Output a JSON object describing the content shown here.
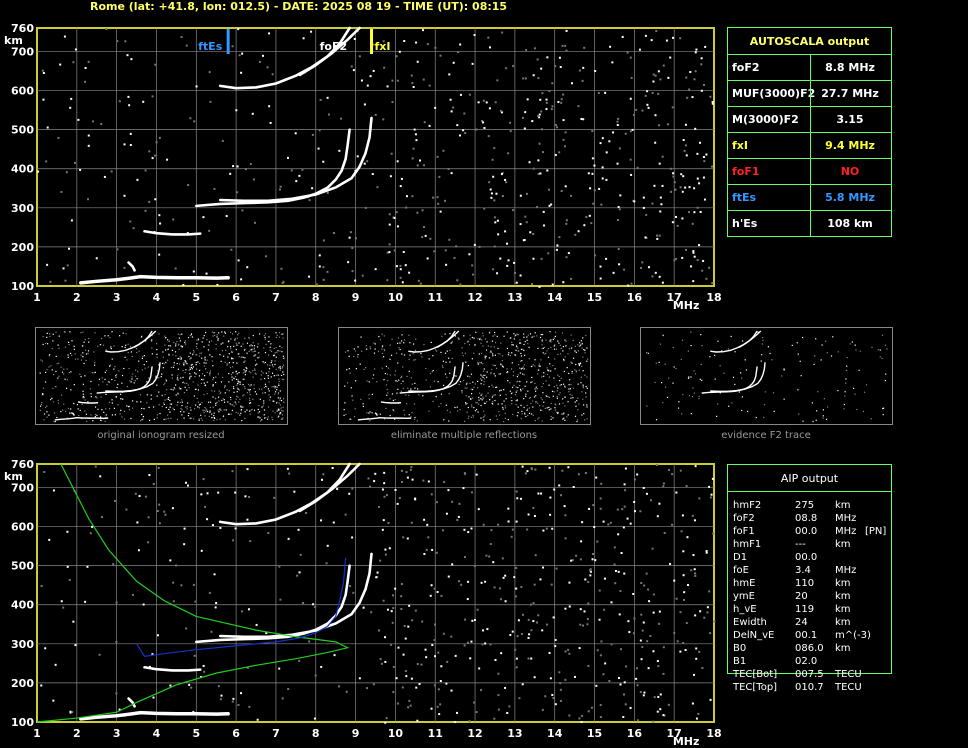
{
  "header": "Rome (lat: +41.8, lon: 012.5) - DATE: 2025 08 19 - TIME (UT): 08:15",
  "axes": {
    "y_ticks": [
      "100",
      "200",
      "300",
      "400",
      "500",
      "600",
      "700",
      "760"
    ],
    "y_unit": "km",
    "x_ticks": [
      "1",
      "2",
      "3",
      "4",
      "5",
      "6",
      "7",
      "8",
      "9",
      "10",
      "11",
      "12",
      "13",
      "14",
      "15",
      "16",
      "17",
      "18"
    ],
    "x_unit": "MHz"
  },
  "markers": [
    {
      "label": "ftEs",
      "freq": 5.8,
      "color": "#3399ff"
    },
    {
      "label": "foF2",
      "freq": 8.8,
      "color": "#ffffff"
    },
    {
      "label": "fxI",
      "freq": 9.4,
      "color": "#ffff33"
    }
  ],
  "autoscala": {
    "title": "AUTOSCALA output",
    "rows": [
      {
        "label": "foF2",
        "value": "8.8 MHz",
        "color": "#ffffff"
      },
      {
        "label": "MUF(3000)F2",
        "value": "27.7 MHz",
        "color": "#ffffff"
      },
      {
        "label": "M(3000)F2",
        "value": "3.15",
        "color": "#ffffff"
      },
      {
        "label": "fxI",
        "value": "9.4 MHz",
        "color": "#ffff33"
      },
      {
        "label": "foF1",
        "value": "NO",
        "color": "#ff2222"
      },
      {
        "label": "ftEs",
        "value": "5.8 MHz",
        "color": "#3399ff"
      },
      {
        "label": "h'Es",
        "value": "108    km",
        "color": "#ffffff"
      }
    ]
  },
  "thumbnails": [
    {
      "caption": "original ionogram resized"
    },
    {
      "caption": "eliminate multiple reflections"
    },
    {
      "caption": "evidence F2 trace"
    }
  ],
  "aip": {
    "title": "AIP output",
    "rows": [
      {
        "name": "hmF2",
        "value": "275",
        "unit": "km",
        "extra": ""
      },
      {
        "name": "foF2",
        "value": "08.8",
        "unit": "MHz",
        "extra": ""
      },
      {
        "name": "foF1",
        "value": "00.0",
        "unit": "MHz",
        "extra": "[PN]"
      },
      {
        "name": "hmF1",
        "value": "---",
        "unit": "km",
        "extra": ""
      },
      {
        "name": "D1",
        "value": "00.0",
        "unit": "",
        "extra": ""
      },
      {
        "name": "foE",
        "value": "3.4",
        "unit": "MHz",
        "extra": ""
      },
      {
        "name": "hmE",
        "value": "110",
        "unit": "km",
        "extra": ""
      },
      {
        "name": "ymE",
        "value": "20",
        "unit": "km",
        "extra": ""
      },
      {
        "name": "h_vE",
        "value": "119",
        "unit": "km",
        "extra": ""
      },
      {
        "name": "Ewidth",
        "value": "24",
        "unit": "km",
        "extra": ""
      },
      {
        "name": "DelN_vE",
        "value": "00.1",
        "unit": "m^(-3)",
        "extra": ""
      },
      {
        "name": "B0",
        "value": "086.0",
        "unit": "km",
        "extra": ""
      },
      {
        "name": "B1",
        "value": "02.0",
        "unit": "",
        "extra": ""
      },
      {
        "name": "TEC[Bot]",
        "value": "007.5",
        "unit": "TECU",
        "extra": ""
      },
      {
        "name": "TEC[Top]",
        "value": "010.7",
        "unit": "TECU",
        "extra": ""
      }
    ]
  },
  "chart_data": {
    "type": "scatter",
    "xlabel": "MHz",
    "ylabel": "km",
    "xlim": [
      1,
      18
    ],
    "ylim": [
      100,
      760
    ],
    "grid": true,
    "colors": {
      "frame": "#cccc33",
      "grid": "#888888",
      "trace": "#ffffff",
      "profile": "#22cc22",
      "fitted": "#1133cc"
    },
    "series": [
      {
        "role": "E-trace",
        "points": [
          [
            2.1,
            108
          ],
          [
            2.5,
            112
          ],
          [
            3.0,
            116
          ],
          [
            3.4,
            121
          ],
          [
            3.6,
            124
          ],
          [
            4.0,
            122
          ],
          [
            4.5,
            121
          ],
          [
            5.0,
            121
          ],
          [
            5.5,
            120
          ],
          [
            5.8,
            121
          ]
        ]
      },
      {
        "role": "Es-blob",
        "points": [
          [
            3.3,
            160
          ],
          [
            3.4,
            150
          ],
          [
            3.45,
            140
          ]
        ]
      },
      {
        "role": "E2-trace",
        "points": [
          [
            3.7,
            240
          ],
          [
            4.0,
            235
          ],
          [
            4.4,
            232
          ],
          [
            4.8,
            232
          ],
          [
            5.1,
            234
          ]
        ]
      },
      {
        "role": "F-lower",
        "points": [
          [
            5.0,
            305
          ],
          [
            5.6,
            310
          ],
          [
            6.2,
            312
          ],
          [
            6.8,
            314
          ],
          [
            7.3,
            318
          ],
          [
            7.7,
            326
          ],
          [
            8.0,
            336
          ],
          [
            8.3,
            352
          ],
          [
            8.5,
            372
          ],
          [
            8.65,
            395
          ],
          [
            8.75,
            425
          ],
          [
            8.8,
            460
          ],
          [
            8.85,
            500
          ]
        ]
      },
      {
        "role": "F-upper",
        "points": [
          [
            5.6,
            320
          ],
          [
            6.2,
            318
          ],
          [
            6.8,
            318
          ],
          [
            7.4,
            323
          ],
          [
            8.0,
            334
          ],
          [
            8.5,
            352
          ],
          [
            8.9,
            376
          ],
          [
            9.1,
            405
          ],
          [
            9.25,
            440
          ],
          [
            9.35,
            480
          ],
          [
            9.4,
            530
          ]
        ]
      },
      {
        "role": "F-high",
        "points": [
          [
            5.6,
            612
          ],
          [
            6.0,
            606
          ],
          [
            6.5,
            608
          ],
          [
            7.0,
            618
          ],
          [
            7.5,
            638
          ],
          [
            7.9,
            660
          ],
          [
            8.3,
            688
          ],
          [
            8.6,
            720
          ],
          [
            8.85,
            760
          ]
        ]
      },
      {
        "role": "F-high-x",
        "points": [
          [
            7.6,
            640
          ],
          [
            8.0,
            665
          ],
          [
            8.4,
            695
          ],
          [
            8.8,
            730
          ],
          [
            9.1,
            760
          ]
        ]
      },
      {
        "role": "density-profile",
        "points": [
          [
            1.0,
            100
          ],
          [
            2.0,
            110
          ],
          [
            3.0,
            125
          ],
          [
            3.5,
            150
          ],
          [
            4.5,
            195
          ],
          [
            5.5,
            225
          ],
          [
            6.5,
            245
          ],
          [
            7.5,
            262
          ],
          [
            8.3,
            278
          ],
          [
            8.8,
            290
          ],
          [
            8.5,
            305
          ],
          [
            7.5,
            318
          ],
          [
            6.5,
            335
          ],
          [
            5.0,
            370
          ],
          [
            4.2,
            410
          ],
          [
            3.5,
            460
          ],
          [
            2.8,
            540
          ],
          [
            2.3,
            620
          ],
          [
            1.9,
            700
          ],
          [
            1.6,
            760
          ]
        ]
      },
      {
        "role": "fitted-profile",
        "points": [
          [
            3.5,
            300
          ],
          [
            3.7,
            268
          ],
          [
            4.2,
            275
          ],
          [
            5.0,
            285
          ],
          [
            6.0,
            295
          ],
          [
            7.0,
            305
          ],
          [
            7.6,
            315
          ],
          [
            8.0,
            328
          ],
          [
            8.3,
            345
          ],
          [
            8.5,
            370
          ],
          [
            8.6,
            410
          ],
          [
            8.7,
            460
          ],
          [
            8.75,
            520
          ]
        ]
      }
    ]
  }
}
